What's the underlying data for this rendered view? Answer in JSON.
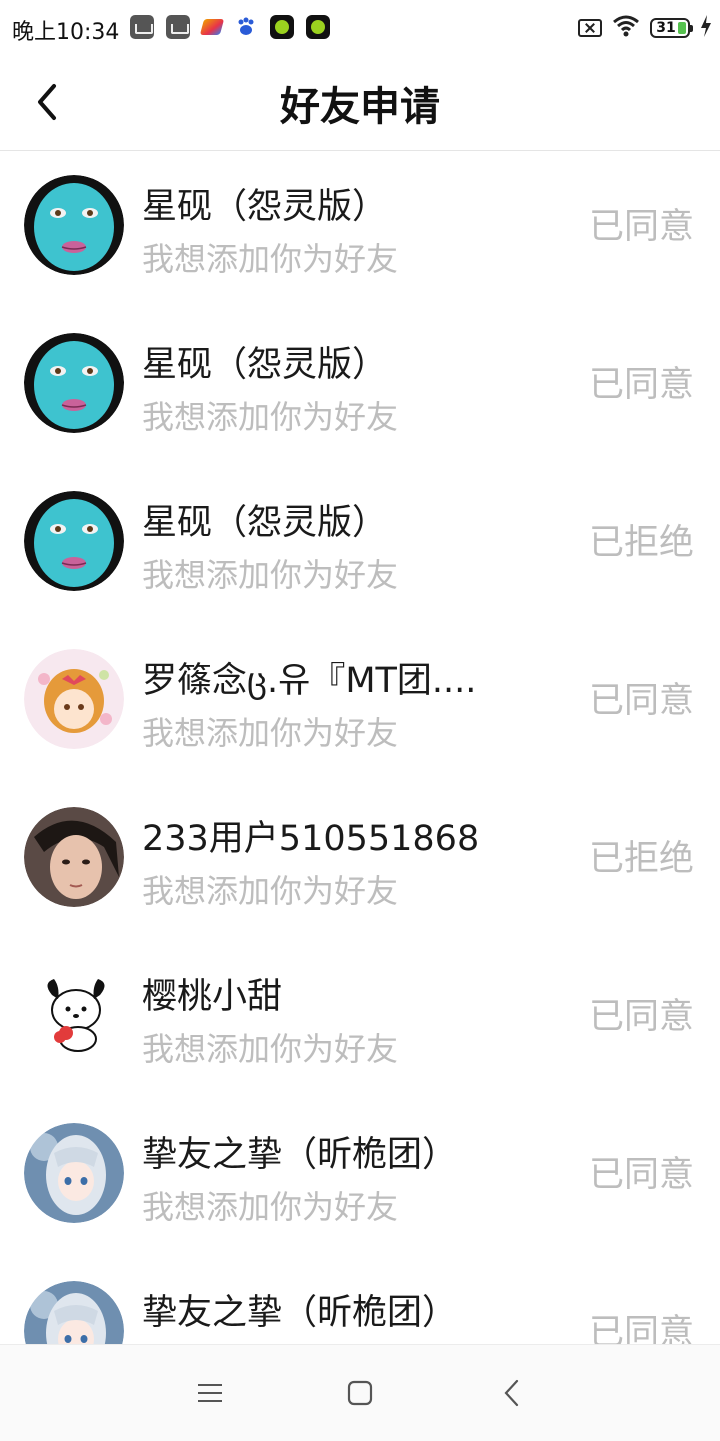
{
  "status_bar": {
    "time": "晚上10:34",
    "battery": "31"
  },
  "header": {
    "title": "好友申请",
    "back_icon": "back-arrow-icon"
  },
  "requests": [
    {
      "name": "星砚（怨灵版）",
      "message": "我想添加你为好友",
      "status": "已同意",
      "avatar": "teal-mask"
    },
    {
      "name": "星砚（怨灵版）",
      "message": "我想添加你为好友",
      "status": "已同意",
      "avatar": "teal-mask"
    },
    {
      "name": "星砚（怨灵版）",
      "message": "我想添加你为好友",
      "status": "已拒绝",
      "avatar": "teal-mask"
    },
    {
      "name": "罗篠念ც.유『MT团....",
      "message": "我想添加你为好友",
      "status": "已同意",
      "avatar": "anime-girl-pink"
    },
    {
      "name": "233用户510551868",
      "message": "我想添加你为好友",
      "status": "已拒绝",
      "avatar": "photo"
    },
    {
      "name": "樱桃小甜",
      "message": "我想添加你为好友",
      "status": "已同意",
      "avatar": "cartoon-dog"
    },
    {
      "name": "挚友之挚（昕桅团）",
      "message": "我想添加你为好友",
      "status": "已同意",
      "avatar": "anime-girl-blue"
    },
    {
      "name": "挚友之挚（昕桅团）",
      "message": "",
      "status": "已同意",
      "avatar": "anime-girl-blue"
    }
  ],
  "navbar": {
    "menu_icon": "menu-icon",
    "home_icon": "home-square-icon",
    "back_icon": "nav-back-icon"
  },
  "colors": {
    "status_text": "#bdbdbd",
    "name_text": "#1a1a1a",
    "mask_teal": "#3ec3cf"
  }
}
